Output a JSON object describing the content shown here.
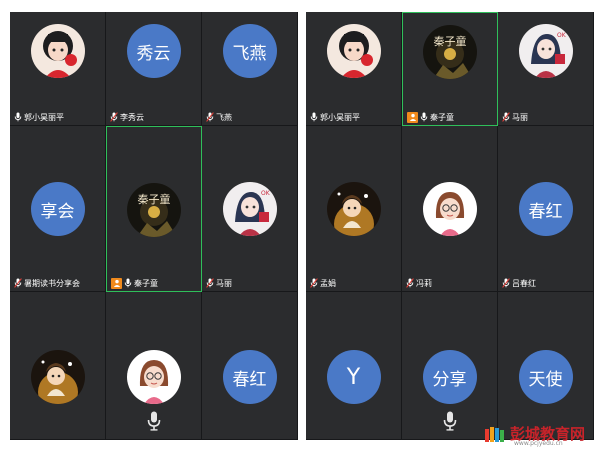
{
  "left_panel": {
    "tiles": [
      {
        "type": "image",
        "icon": "avatar-girl-red-icon",
        "name": "郭小昊丽平",
        "mic": "mic-icon"
      },
      {
        "type": "text",
        "avatar_text": "秀云",
        "name": "李秀云",
        "mic": "mic-muted-icon"
      },
      {
        "type": "text",
        "avatar_text": "飞燕",
        "name": "飞燕",
        "mic": "mic-muted-icon"
      },
      {
        "type": "text",
        "avatar_text": "享会",
        "name": "暑期读书分享会",
        "mic": "mic-muted-icon"
      },
      {
        "type": "image",
        "icon": "avatar-night-text-icon",
        "name": "秦子童",
        "mic": "mic-icon",
        "host": true,
        "active": true
      },
      {
        "type": "image",
        "icon": "avatar-anime-girl-icon",
        "name": "马丽",
        "mic": "mic-muted-icon"
      },
      {
        "type": "image",
        "icon": "avatar-cartoon-girl-icon",
        "name": ""
      },
      {
        "type": "image",
        "icon": "avatar-glasses-girl-icon",
        "name": "",
        "bottom_mic": true
      },
      {
        "type": "text",
        "avatar_text": "春红",
        "name": ""
      }
    ]
  },
  "right_panel": {
    "tiles": [
      {
        "type": "image",
        "icon": "avatar-girl-red-icon",
        "name": "郭小昊丽平",
        "mic": "mic-icon"
      },
      {
        "type": "image",
        "icon": "avatar-night-text-icon",
        "name": "秦子童",
        "mic": "mic-icon",
        "host": true,
        "active": true
      },
      {
        "type": "image",
        "icon": "avatar-anime-girl-icon",
        "name": "马丽",
        "mic": "mic-muted-icon"
      },
      {
        "type": "image",
        "icon": "avatar-cartoon-girl-icon",
        "name": "孟娟",
        "mic": "mic-muted-icon"
      },
      {
        "type": "image",
        "icon": "avatar-glasses-girl-icon",
        "name": "冯莉",
        "mic": "mic-muted-icon"
      },
      {
        "type": "text",
        "avatar_text": "春红",
        "name": "吕春红",
        "mic": "mic-muted-icon"
      },
      {
        "type": "text",
        "avatar_text": "Y",
        "name": "",
        "big": true
      },
      {
        "type": "text",
        "avatar_text": "分享",
        "name": "",
        "bottom_mic": true
      },
      {
        "type": "text",
        "avatar_text": "天使",
        "name": ""
      }
    ]
  },
  "watermark": {
    "title": "彭城教育网",
    "url": "www.pcjyedu.cn"
  },
  "colors": {
    "panel_bg": "#2b2c2e",
    "avatar_blue": "#4a79c7",
    "active_border": "#2fbf5a",
    "host_badge": "#f08a1c",
    "watermark_red": "#c8232a"
  }
}
